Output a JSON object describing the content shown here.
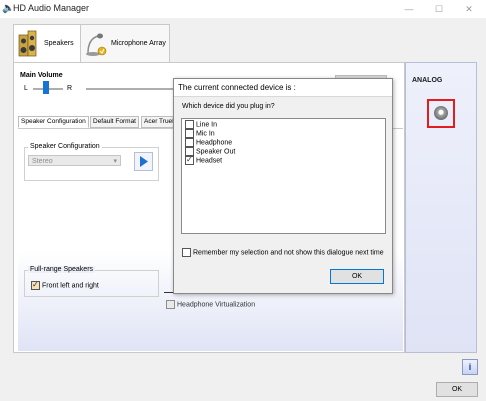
{
  "window": {
    "title": "HD Audio Manager",
    "controls": [
      "—",
      "☐",
      "✕"
    ]
  },
  "device_tabs": [
    {
      "label": "Speakers",
      "icon": "speakers-icon",
      "active": true
    },
    {
      "label": "Microphone Array",
      "icon": "microphone-icon",
      "active": false
    }
  ],
  "main_volume": {
    "label": "Main Volume",
    "left": "L",
    "right": "R"
  },
  "sub_tabs": [
    {
      "label": "Speaker Configuration",
      "active": true
    },
    {
      "label": "Default Format",
      "active": false
    },
    {
      "label": "Acer TrueH",
      "active": false
    }
  ],
  "speaker_config": {
    "group_label": "Speaker Configuration",
    "select_value": "Stereo",
    "play_icon": "play-icon"
  },
  "full_range": {
    "group_label": "Full-range Speakers",
    "checkbox_label": "Front left and right",
    "checked": true
  },
  "headphone_virtualization": {
    "label": "Headphone Virtualization",
    "checked": false
  },
  "analog_panel": {
    "title": "ANALOG",
    "jack_icon": "audio-jack-icon",
    "highlight_color": "#e21d1d"
  },
  "info_icon": "info-icon",
  "ok_label": "OK",
  "dialog": {
    "title": "The current connected device is :",
    "question": "Which device did you plug in?",
    "devices": [
      {
        "label": "Line In",
        "checked": false
      },
      {
        "label": "Mic In",
        "checked": false
      },
      {
        "label": "Headphone",
        "checked": false
      },
      {
        "label": "Speaker Out",
        "checked": false
      },
      {
        "label": "Headset",
        "checked": true
      }
    ],
    "remember_label": "Remember my selection and not show this dialogue next time",
    "remember_checked": false,
    "ok_label": "OK"
  }
}
